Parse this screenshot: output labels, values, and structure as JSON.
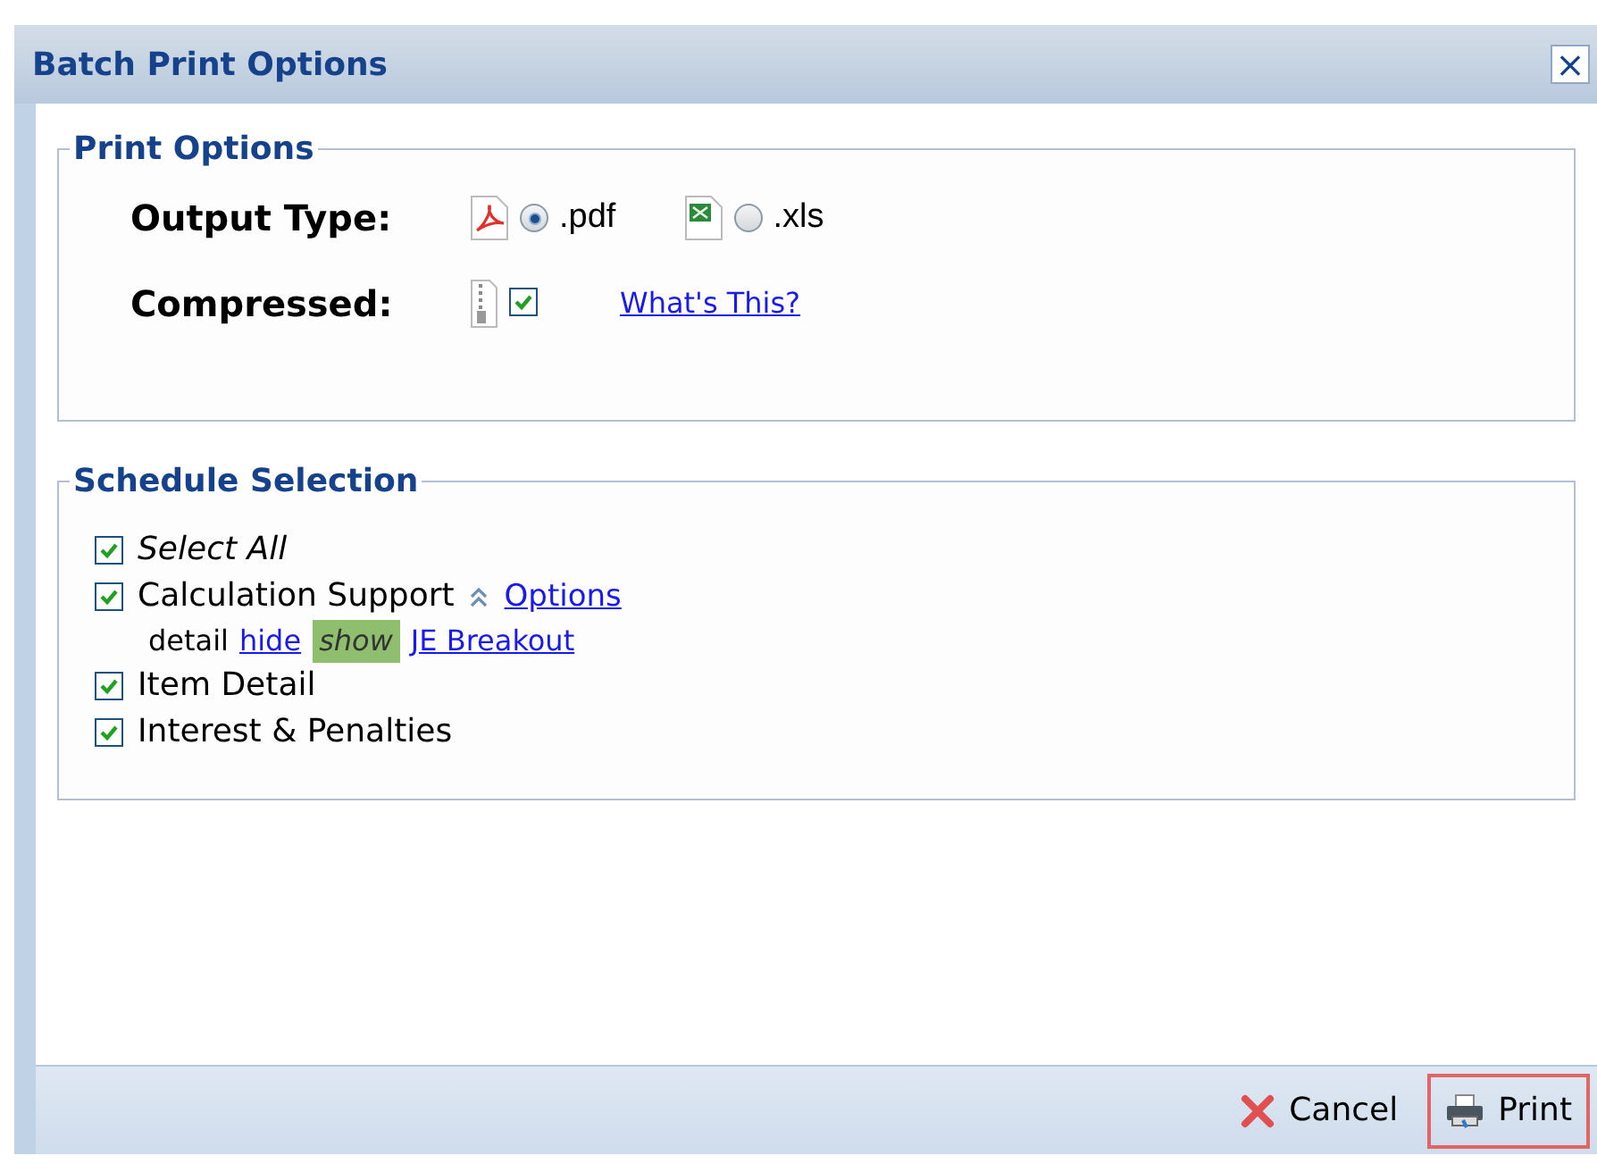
{
  "window": {
    "title": "Batch Print Options",
    "close": "×"
  },
  "print_options": {
    "legend": "Print Options",
    "output_type": {
      "label": "Output Type:",
      "options": [
        {
          "kind": "pdf",
          "label": ".pdf",
          "selected": true
        },
        {
          "kind": "xls",
          "label": ".xls",
          "selected": false
        }
      ]
    },
    "compressed": {
      "label": "Compressed:",
      "checked": true,
      "help_link": "What's This?"
    }
  },
  "schedule_selection": {
    "legend": "Schedule Selection",
    "select_all": {
      "label": "Select All",
      "checked": true
    },
    "items": [
      {
        "label": "Calculation Support",
        "checked": true,
        "expanded": true,
        "options_link": "Options",
        "detail_label": "detail",
        "detail_options": [
          {
            "label": "hide",
            "selected": false
          },
          {
            "label": "show",
            "selected": true
          }
        ],
        "extra_link": "JE Breakout"
      },
      {
        "label": "Item Detail",
        "checked": true
      },
      {
        "label": "Interest & Penalties",
        "checked": true
      }
    ]
  },
  "footer": {
    "buttons": [
      {
        "kind": "cancel",
        "label": "Cancel",
        "focused": false
      },
      {
        "kind": "print",
        "label": "Print",
        "focused": true
      }
    ]
  }
}
